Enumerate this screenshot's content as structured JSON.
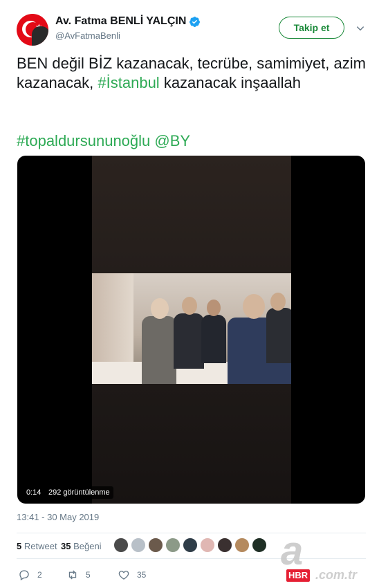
{
  "author": {
    "display_name": "Av. Fatma BENLİ YALÇIN",
    "handle": "@AvFatmaBenli",
    "verified": true
  },
  "follow_button_label": "Takip et",
  "tweet": {
    "text_part1": "BEN değil BİZ kazanacak, tecrübe, samimiyet, azim kazanacak, ",
    "hashtag1": "#İstanbul",
    "text_part2": " kazanacak inşaallah",
    "hashtag2": "#topaldursununoğlu",
    "mention": "@BY"
  },
  "video": {
    "duration": "0:14",
    "views": "292 görüntülenme"
  },
  "timestamp": "13:41 - 30 May 2019",
  "stats": {
    "retweets_count": "5",
    "retweets_label": "Retweet",
    "likes_count": "35",
    "likes_label": "Beğeni"
  },
  "actions": {
    "replies": "2",
    "retweets": "5",
    "likes": "35"
  },
  "watermark": {
    "letter": "a",
    "brand": "HBR",
    "domain": ".com.tr"
  },
  "colors": {
    "hashtag": "#2eaa55",
    "follow": "#1b8a3a",
    "verified": "#1da1f2",
    "muted": "#657786"
  },
  "icons": [
    "verified-badge-icon",
    "chevron-down-icon",
    "reply-icon",
    "retweet-icon",
    "like-icon"
  ]
}
